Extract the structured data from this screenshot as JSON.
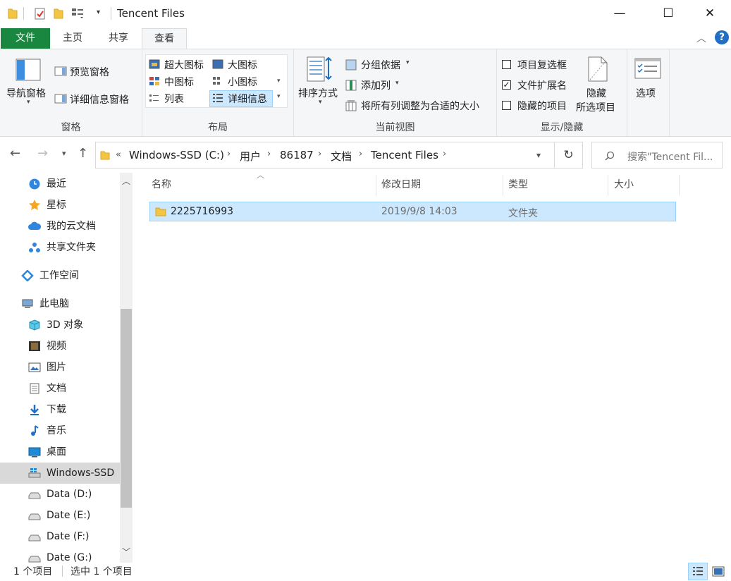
{
  "window": {
    "title": "Tencent Files",
    "minimize_glyph": "—",
    "maximize_glyph": "☐",
    "close_glyph": "✕"
  },
  "tabs": {
    "file": "文件",
    "home": "主页",
    "share": "共享",
    "view": "查看"
  },
  "ribbon": {
    "panes": {
      "label": "窗格",
      "nav_pane": "导航窗格",
      "preview_pane": "预览窗格",
      "details_pane": "详细信息窗格"
    },
    "layout": {
      "label": "布局",
      "extra_large": "超大图标",
      "large": "大图标",
      "medium": "中图标",
      "small": "小图标",
      "list": "列表",
      "details": "详细信息"
    },
    "current_view": {
      "label": "当前视图",
      "sort_by": "排序方式",
      "group_by": "分组依据",
      "add_columns": "添加列",
      "size_all_columns": "将所有列调整为合适的大小"
    },
    "show_hide": {
      "label": "显示/隐藏",
      "item_checkboxes": "项目复选框",
      "file_extensions": "文件扩展名",
      "hidden_items": "隐藏的项目",
      "hide_selected_1": "隐藏",
      "hide_selected_2": "所选项目",
      "checkbox_item_checkboxes": false,
      "checkbox_file_extensions": true,
      "checkbox_hidden_items": false
    },
    "options": "选项"
  },
  "address": {
    "overflow": "«",
    "crumbs": [
      "Windows-SSD (C:)",
      "用户",
      "86187",
      "文档",
      "Tencent Files"
    ],
    "search_placeholder": "搜索\"Tencent Fil..."
  },
  "sidebar": {
    "items": [
      {
        "label": "最近",
        "icon": "clock-icon"
      },
      {
        "label": "星标",
        "icon": "star-icon"
      },
      {
        "label": "我的云文档",
        "icon": "cloud-icon"
      },
      {
        "label": "共享文件夹",
        "icon": "share-icon"
      },
      {
        "label": "工作空间",
        "icon": "workspace-icon"
      },
      {
        "label": "此电脑",
        "icon": "computer-icon"
      },
      {
        "label": "3D 对象",
        "icon": "cube-icon"
      },
      {
        "label": "视频",
        "icon": "video-icon"
      },
      {
        "label": "图片",
        "icon": "picture-icon"
      },
      {
        "label": "文档",
        "icon": "document-icon"
      },
      {
        "label": "下载",
        "icon": "download-icon"
      },
      {
        "label": "音乐",
        "icon": "music-icon"
      },
      {
        "label": "桌面",
        "icon": "desktop-icon"
      },
      {
        "label": "Windows-SSD",
        "icon": "windows-drive-icon"
      },
      {
        "label": "Data (D:)",
        "icon": "drive-icon"
      },
      {
        "label": "Date (E:)",
        "icon": "drive-icon"
      },
      {
        "label": "Date (F:)",
        "icon": "drive-icon"
      },
      {
        "label": "Date (G:)",
        "icon": "drive-icon"
      }
    ]
  },
  "columns": {
    "name": "名称",
    "modified": "修改日期",
    "type": "类型",
    "size": "大小"
  },
  "files": [
    {
      "name": "2225716993",
      "modified": "2019/9/8 14:03",
      "type": "文件夹",
      "size": ""
    }
  ],
  "status": {
    "count": "1 个项目",
    "selected": "选中 1 个项目"
  },
  "colors": {
    "file_tab": "#19873f",
    "selection": "#cce8ff",
    "selection_border": "#99d1ff",
    "folder": "#f4c542"
  }
}
